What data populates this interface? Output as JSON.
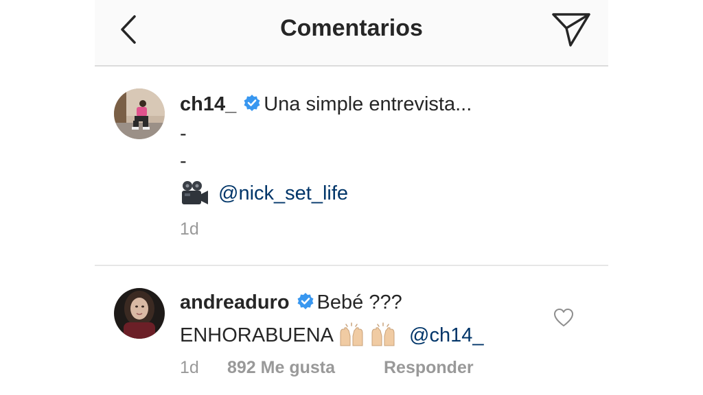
{
  "header": {
    "title": "Comentarios",
    "back_icon": "chevron-left-icon",
    "send_icon": "paper-plane-icon"
  },
  "post": {
    "username": "ch14_",
    "caption": "Una simple entrevista...",
    "dash1": "-",
    "dash2": "-",
    "camera_icon": "movie-camera-icon",
    "mention": "@nick_set_life",
    "time": "1d"
  },
  "comment": {
    "username": "andreaduro",
    "text1": "Bebé ???",
    "text2": "ENHORABUENA",
    "emoji": "raised-hands-icon",
    "mention": "@ch14_",
    "time": "1d",
    "likes": "892 Me gusta",
    "reply": "Responder",
    "heart_icon": "heart-outline-icon"
  },
  "colors": {
    "mention": "#003569",
    "verified": "#3897f0",
    "muted": "#999999",
    "divider": "#dbdbdb"
  }
}
